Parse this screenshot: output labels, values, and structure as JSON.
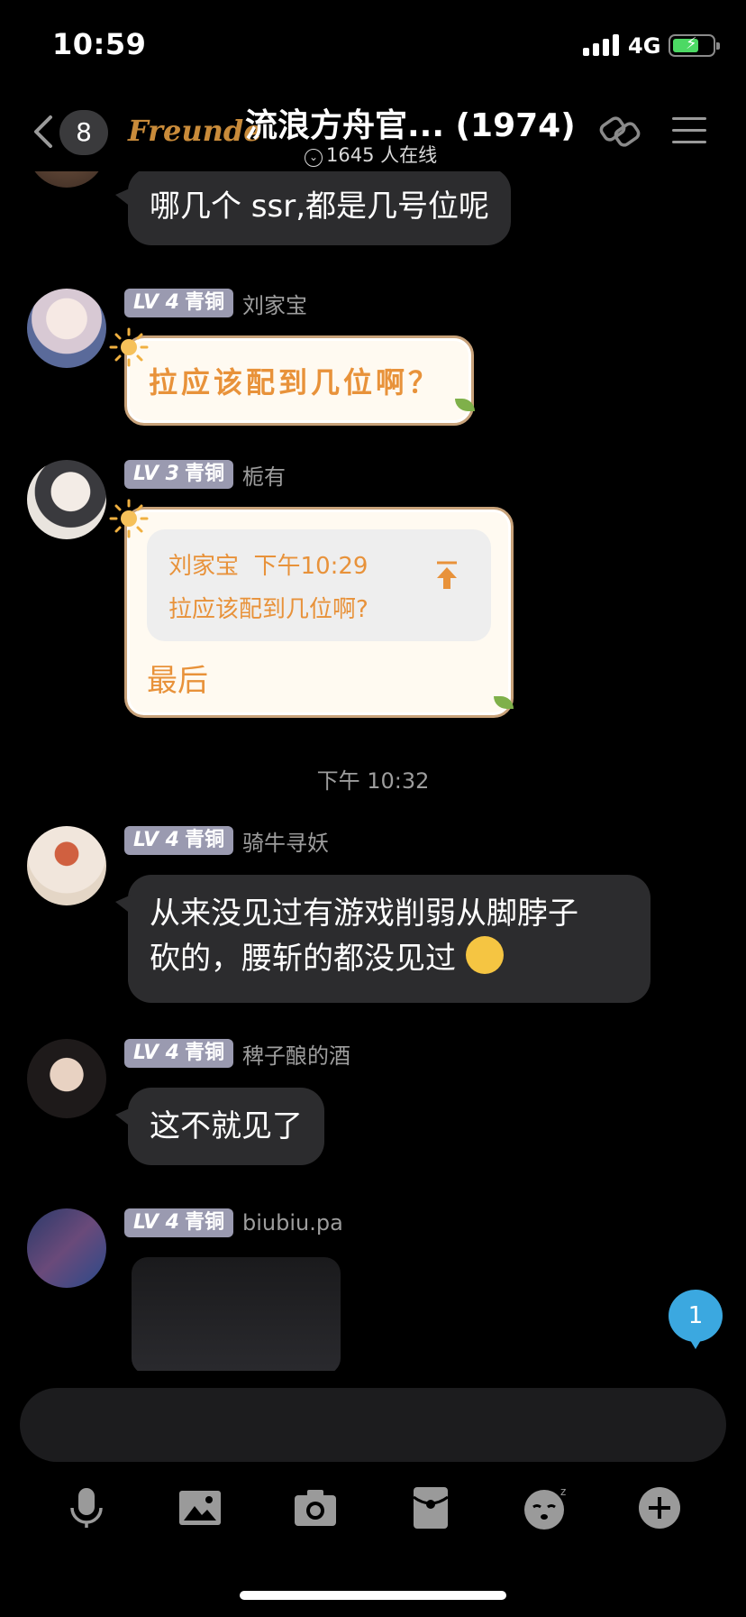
{
  "status": {
    "time": "10:59",
    "network": "4G"
  },
  "header": {
    "unread_count": "8",
    "logo_text": "Freunde",
    "group_title": "流浪方舟官... (1974)",
    "online_text": "1645 人在线"
  },
  "messages": [
    {
      "text": "哪几个 ssr,都是几号位呢"
    },
    {
      "level": "LV 4",
      "rank": "青铜",
      "sender": "刘家宝",
      "text": "拉应该配到几位啊？"
    },
    {
      "level": "LV 3",
      "rank": "青铜",
      "sender": "栀有",
      "quote": {
        "author": "刘家宝",
        "time": "下午10:29",
        "text": "拉应该配到几位啊?"
      },
      "text": "最后"
    },
    {
      "timestamp": "下午 10:32"
    },
    {
      "level": "LV 4",
      "rank": "青铜",
      "sender": "骑牛寻妖",
      "lines": [
        "从来没见过有游戏削弱从脚脖子",
        "砍的，腰斩的都没见过"
      ]
    },
    {
      "level": "LV 4",
      "rank": "青铜",
      "sender": "稗子酿的酒",
      "text": "这不就见了"
    },
    {
      "level": "LV 4",
      "rank": "青铜",
      "sender": "biubiu.pa"
    }
  ],
  "new_message_badge": "1",
  "colors": {
    "accent_orange": "#e8923a",
    "bubble_dark": "#2c2c2e",
    "badge_blue": "#3ba8e0"
  },
  "toolbar_icons": [
    "microphone-icon",
    "image-icon",
    "camera-icon",
    "red-packet-icon",
    "emoji-icon",
    "plus-icon"
  ]
}
